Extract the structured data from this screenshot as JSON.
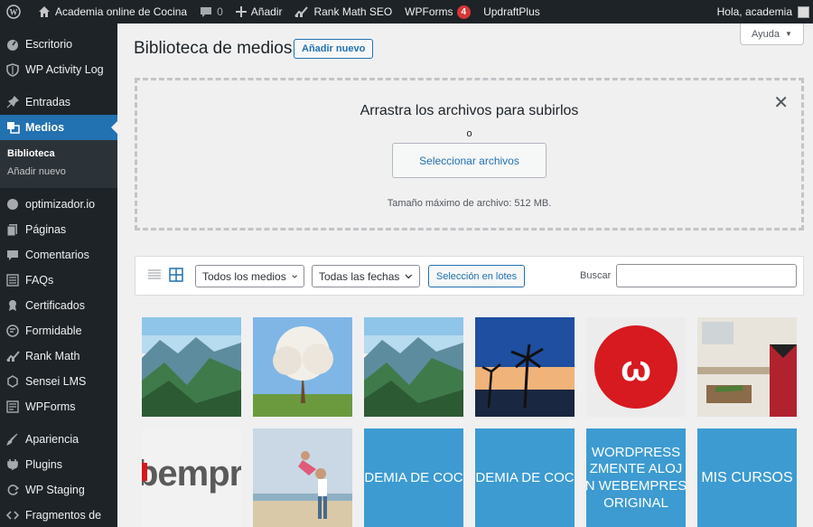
{
  "adminbar": {
    "site_name": "Academia online de Cocina",
    "comments_count": "0",
    "add_new": "Añadir",
    "rankmath": "Rank Math SEO",
    "wpforms": "WPForms",
    "wpforms_count": "4",
    "updraft": "UpdraftPlus",
    "greeting": "Hola, academia"
  },
  "sidebar": {
    "items": [
      {
        "label": "Escritorio",
        "icon": "dashboard-icon"
      },
      {
        "label": "WP Activity Log",
        "icon": "shield-icon"
      },
      {
        "label": "Entradas",
        "icon": "pin-icon"
      },
      {
        "label": "Medios",
        "icon": "media-icon"
      },
      {
        "label": "optimizador.io",
        "icon": "gauge-icon"
      },
      {
        "label": "Páginas",
        "icon": "pages-icon"
      },
      {
        "label": "Comentarios",
        "icon": "comment-icon"
      },
      {
        "label": "FAQs",
        "icon": "list-icon"
      },
      {
        "label": "Certificados",
        "icon": "award-icon"
      },
      {
        "label": "Formidable",
        "icon": "formidable-icon"
      },
      {
        "label": "Rank Math",
        "icon": "chart-icon"
      },
      {
        "label": "Sensei LMS",
        "icon": "sensei-icon"
      },
      {
        "label": "WPForms",
        "icon": "forms-icon"
      },
      {
        "label": "Apariencia",
        "icon": "brush-icon"
      },
      {
        "label": "Plugins",
        "icon": "plugin-icon"
      },
      {
        "label": "WP Staging",
        "icon": "staging-icon"
      },
      {
        "label": "Fragmentos de",
        "icon": "code-icon"
      }
    ],
    "submenu": [
      {
        "label": "Biblioteca"
      },
      {
        "label": "Añadir nuevo"
      }
    ]
  },
  "help": "Ayuda",
  "page": {
    "title": "Biblioteca de medios",
    "add_new": "Añadir nuevo"
  },
  "dropzone": {
    "title": "Arrastra los archivos para subirlos",
    "or": "o",
    "button": "Seleccionar archivos",
    "max": "Tamaño máximo de archivo: 512 MB."
  },
  "toolbar": {
    "filter_type": "Todos los medios",
    "filter_date": "Todas las fechas",
    "bulk": "Selección en lotes",
    "search_label": "Buscar",
    "search_value": ""
  },
  "tiles": {
    "t9": "DEMIA DE COC",
    "t10": "DEMIA DE COC",
    "t11": "WORDPRESS\nZMENTE ALOJ\nN WEBEMPRES\nORIGINAL",
    "t12": "MIS CURSOS",
    "t7": "bempr"
  },
  "colors": {
    "accent": "#2271b1",
    "admin_dark": "#1d2327",
    "tile_blue": "#3d9bd1",
    "badge_red": "#d63638"
  }
}
